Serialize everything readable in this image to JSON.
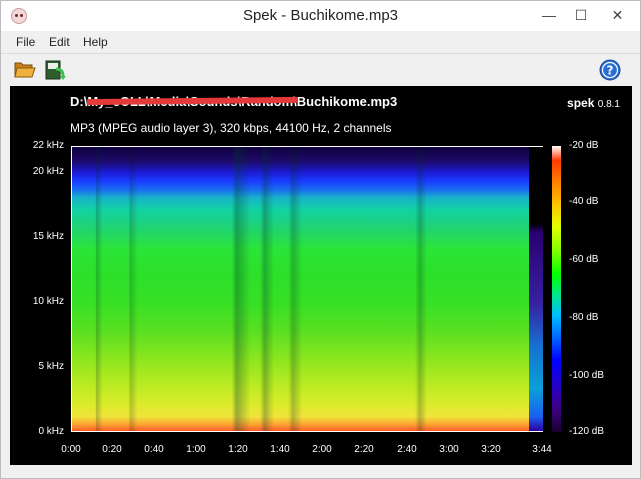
{
  "window": {
    "title": "Spek - Buchikome.mp3",
    "controls": {
      "minimize": "—",
      "maximize": "☐",
      "close": "✕"
    }
  },
  "menu": {
    "items": [
      {
        "label": "File"
      },
      {
        "label": "Edit"
      },
      {
        "label": "Help"
      }
    ]
  },
  "toolbar": {
    "open_icon": "folder-open-icon",
    "save_icon": "save-icon",
    "help_icon": "help-icon"
  },
  "viewer": {
    "file_path": "D:\\My_cOLL\\Media\\Sounds\\Random\\Buchikome.mp3",
    "file_info": "MP3 (MPEG audio layer 3), 320 kbps, 44100 Hz, 2 channels",
    "brand_name": "spek",
    "brand_version": "0.8.1",
    "y_ticks": [
      "22 kHz",
      "20 kHz",
      "15 kHz",
      "10 kHz",
      "5 kHz",
      "0 kHz"
    ],
    "x_ticks": [
      "0:00",
      "0:20",
      "0:40",
      "1:00",
      "1:20",
      "1:40",
      "2:00",
      "2:20",
      "2:40",
      "3:00",
      "3:20",
      "3:44"
    ],
    "colorbar_ticks": [
      "-20 dB",
      "-40 dB",
      "-60 dB",
      "-80 dB",
      "-100 dB",
      "-120 dB"
    ]
  },
  "colors": {
    "background": "#000000",
    "chrome": "#f0f0f0",
    "redaction": "#e53a3a"
  }
}
